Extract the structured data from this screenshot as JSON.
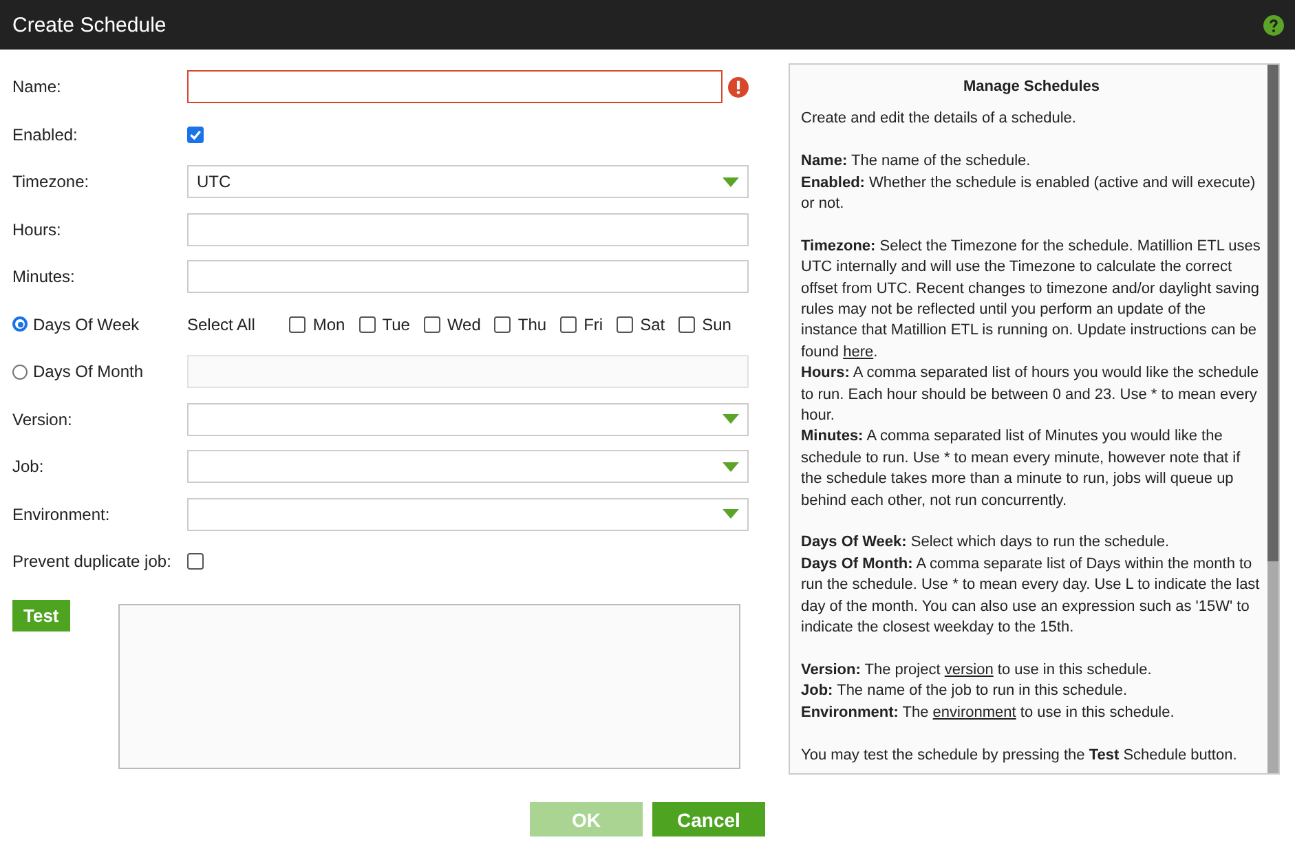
{
  "window": {
    "title": "Create Schedule"
  },
  "form": {
    "fields": [
      {
        "kind": "text",
        "label": "Name:",
        "invalid": true
      },
      {
        "kind": "checkbox",
        "label": "Enabled:",
        "checked": true
      },
      {
        "kind": "select",
        "label": "Timezone:",
        "value": "UTC"
      },
      {
        "kind": "text",
        "label": "Hours:",
        "invalid": false
      },
      {
        "kind": "text",
        "label": "Minutes:",
        "invalid": false
      },
      {
        "kind": "days",
        "label": "Days Of Week",
        "selected": true,
        "select_all": "Select All",
        "days": [
          {
            "label": "Mon",
            "checked": false
          },
          {
            "label": "Tue",
            "checked": false
          },
          {
            "label": "Wed",
            "checked": false
          },
          {
            "label": "Thu",
            "checked": false
          },
          {
            "label": "Fri",
            "checked": false
          },
          {
            "label": "Sat",
            "checked": false
          },
          {
            "label": "Sun",
            "checked": false
          }
        ]
      },
      {
        "kind": "radio-text",
        "label": "Days Of Month",
        "selected": false,
        "disabled": true
      },
      {
        "kind": "select",
        "label": "Version:"
      },
      {
        "kind": "select",
        "label": "Job:"
      },
      {
        "kind": "select",
        "label": "Environment:"
      },
      {
        "kind": "checkbox",
        "label": "Prevent duplicate job:",
        "checked": false
      }
    ],
    "test_button": "Test"
  },
  "help": {
    "title": "Manage Schedules",
    "groups": [
      [
        {
          "text": "Create and edit the details of a schedule."
        }
      ],
      [
        {
          "term": "Name:",
          "text": "The name of the schedule."
        },
        {
          "term": "Enabled:",
          "text": "Whether the schedule is enabled (active and will execute) or not."
        }
      ],
      [
        {
          "term": "Timezone:",
          "text": "Select the Timezone for the schedule. Matillion ETL uses UTC internally and will use the Timezone to calculate the correct offset from UTC. Recent changes to timezone and/or daylight saving rules may not be reflected until you perform an update of the instance that Matillion ETL is running on. Update instructions can be found",
          "link": "here",
          "after": "."
        },
        {
          "term": "Hours:",
          "text": "A comma separated list of hours you would like the schedule to run. Each hour should be between 0 and 23. Use * to mean every hour."
        },
        {
          "term": "Minutes:",
          "text": "A comma separated list of Minutes you would like the schedule to run. Use * to mean every minute, however note that if the schedule takes more than a minute to run, jobs will queue up behind each other, not run concurrently."
        }
      ],
      [
        {
          "term": "Days Of Week:",
          "text": "Select which days to run the schedule."
        },
        {
          "term": "Days Of Month:",
          "text": "A comma separate list of Days within the month to run the schedule. Use * to mean every day. Use L to indicate the last day of the month. You can also use an expression such as '15W' to indicate the closest weekday to the 15th."
        }
      ],
      [
        {
          "term": "Version:",
          "text": "The project",
          "link": "version",
          "after": "to use in this schedule."
        },
        {
          "term": "Job:",
          "text": "The name of the job to run in this schedule."
        },
        {
          "term": "Environment:",
          "text": "The",
          "link": "environment",
          "after": "to use in this schedule."
        }
      ],
      [
        {
          "text": "You may test the schedule by pressing the **Test** Schedule button."
        }
      ]
    ]
  },
  "buttons": [
    {
      "label": "OK",
      "disabled": true
    },
    {
      "label": "Cancel",
      "disabled": false
    }
  ]
}
